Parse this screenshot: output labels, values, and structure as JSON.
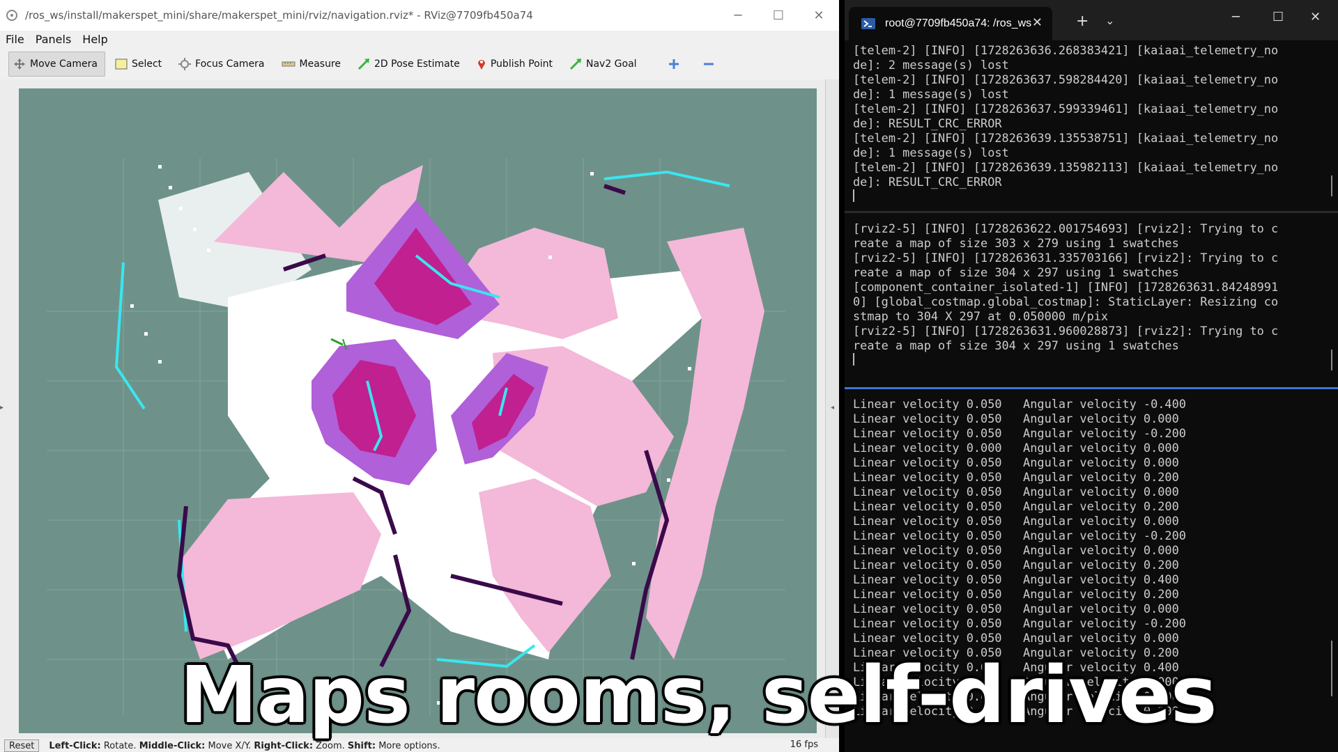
{
  "rviz": {
    "title": "/ros_ws/install/makerspet_mini/share/makerspet_mini/rviz/navigation.rviz* - RViz@7709fb450a74",
    "window_controls": {
      "minimize": "─",
      "maximize": "☐",
      "close": "✕"
    },
    "menu": [
      "File",
      "Panels",
      "Help"
    ],
    "tools": [
      {
        "label": "Move Camera",
        "icon": "move-camera-icon",
        "active": true
      },
      {
        "label": "Select",
        "icon": "select-icon"
      },
      {
        "label": "Focus Camera",
        "icon": "focus-camera-icon"
      },
      {
        "label": "Measure",
        "icon": "ruler-icon"
      },
      {
        "label": "2D Pose Estimate",
        "icon": "green-arrow-icon"
      },
      {
        "label": "Publish Point",
        "icon": "map-pin-icon"
      },
      {
        "label": "Nav2 Goal",
        "icon": "green-arrow-icon"
      }
    ],
    "status": {
      "reset": "Reset",
      "hint_left_click": "Left-Click:",
      "hint_rotate": "Rotate.",
      "hint_middle_click": "Middle-Click:",
      "hint_move": "Move X/Y.",
      "hint_right_click": "Right-Click:",
      "hint_zoom": "Zoom.",
      "hint_shift": "Shift:",
      "hint_more": "More options.",
      "fps": "16 fps"
    }
  },
  "terminal": {
    "tab_title": "root@7709fb450a74: /ros_ws",
    "tab_close": "✕",
    "new_tab": "+",
    "dropdown": "⌄",
    "window_controls": {
      "minimize": "─",
      "maximize": "☐",
      "close": "✕"
    },
    "pane1": "[telem-2] [INFO] [1728263636.268383421] [kaiaai_telemetry_no\nde]: 2 message(s) lost\n[telem-2] [INFO] [1728263637.598284420] [kaiaai_telemetry_no\nde]: 1 message(s) lost\n[telem-2] [INFO] [1728263637.599339461] [kaiaai_telemetry_no\nde]: RESULT_CRC_ERROR\n[telem-2] [INFO] [1728263639.135538751] [kaiaai_telemetry_no\nde]: 1 message(s) lost\n[telem-2] [INFO] [1728263639.135982113] [kaiaai_telemetry_no\nde]: RESULT_CRC_ERROR",
    "pane2": "[rviz2-5] [INFO] [1728263622.001754693] [rviz2]: Trying to c\nreate a map of size 303 x 279 using 1 swatches\n[rviz2-5] [INFO] [1728263631.335703166] [rviz2]: Trying to c\nreate a map of size 304 x 297 using 1 swatches\n[component_container_isolated-1] [INFO] [1728263631.84248991\n0] [global_costmap.global_costmap]: StaticLayer: Resizing co\nstmap to 304 X 297 at 0.050000 m/pix\n[rviz2-5] [INFO] [1728263631.960028873] [rviz2]: Trying to c\nreate a map of size 304 x 297 using 1 swatches",
    "pane3": "Linear velocity 0.050   Angular velocity -0.400\nLinear velocity 0.050   Angular velocity 0.000\nLinear velocity 0.050   Angular velocity -0.200\nLinear velocity 0.000   Angular velocity 0.000\nLinear velocity 0.050   Angular velocity 0.000\nLinear velocity 0.050   Angular velocity 0.200\nLinear velocity 0.050   Angular velocity 0.000\nLinear velocity 0.050   Angular velocity 0.200\nLinear velocity 0.050   Angular velocity 0.000\nLinear velocity 0.050   Angular velocity -0.200\nLinear velocity 0.050   Angular velocity 0.000\nLinear velocity 0.050   Angular velocity 0.200\nLinear velocity 0.050   Angular velocity 0.400\nLinear velocity 0.050   Angular velocity 0.200\nLinear velocity 0.050   Angular velocity 0.000\nLinear velocity 0.050   Angular velocity -0.200\nLinear velocity 0.050   Angular velocity 0.000\nLinear velocity 0.050   Angular velocity 0.200\nLinear velocity 0.050   Angular velocity 0.400\nLinear velocity 0.050   Angular velocity 0.000\nLinear velocity 0.050   Angular velocity 0.200\nLinear velocity 0.050   Angular velocity 0.200"
  },
  "caption": "Maps rooms, self-drives",
  "colors": {
    "map_bg": "#6e928a",
    "costmap_pink": "#f4b8d8",
    "costmap_purple": "#b060d8",
    "costmap_magenta": "#c02090",
    "obstacle_cyan": "#39e6f0",
    "wall_dark": "#3a0a4a"
  }
}
